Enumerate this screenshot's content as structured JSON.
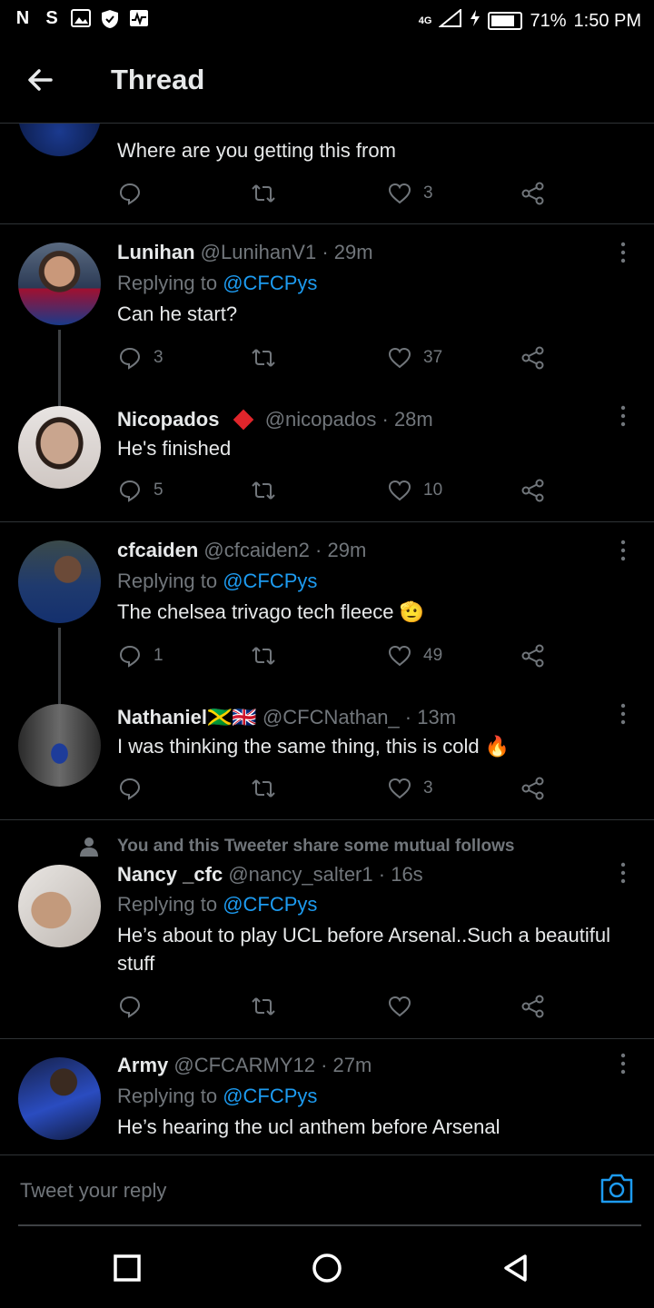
{
  "status_bar": {
    "left_icons": [
      "N",
      "S",
      "gallery-icon",
      "shield-icon",
      "activity-icon"
    ],
    "network": "4G",
    "battery": "71%",
    "battery_level": 0.71,
    "time": "1:50 PM"
  },
  "header": {
    "title": "Thread",
    "back_icon": "arrow-left-icon"
  },
  "tweets": [
    {
      "body": "Where are you getting this from",
      "replies": "",
      "likes": "3"
    },
    {
      "name": "Lunihan",
      "handle": "@LunihanV1",
      "time": "29m",
      "replying_prefix": "Replying to",
      "replying_to": "@CFCPys",
      "body": "Can he start?",
      "replies": "3",
      "likes": "37"
    },
    {
      "name": "Nicopados",
      "badge": "red-diamond-icon",
      "handle": "@nicopados",
      "time": "28m",
      "body": "He's finished",
      "replies": "5",
      "likes": "10"
    },
    {
      "name": "cfcaiden",
      "handle": "@cfcaiden2",
      "time": "29m",
      "replying_prefix": "Replying to",
      "replying_to": "@CFCPys",
      "body": "The chelsea trivago tech fleece 🫡",
      "replies": "1",
      "likes": "49"
    },
    {
      "name": "Nathaniel🇯🇲🇬🇧",
      "handle": "@CFCNathan_",
      "time": "13m",
      "body": "I was thinking the same thing, this is cold 🔥",
      "replies": "",
      "likes": "3"
    },
    {
      "social_context": "You and this Tweeter share some mutual follows",
      "name": "Nancy _cfc",
      "handle": "@nancy_salter1",
      "time": "16s",
      "replying_prefix": "Replying to",
      "replying_to": "@CFCPys",
      "body": "He’s about to play UCL before Arsenal..Such a beautiful stuff",
      "replies": "",
      "likes": ""
    },
    {
      "name": "Army",
      "handle": "@CFCARMY12",
      "time": "27m",
      "replying_prefix": "Replying to",
      "replying_to": "@CFCPys",
      "body": "He’s hearing the ucl anthem before Arsenal"
    }
  ],
  "reply_bar": {
    "placeholder": "Tweet your reply",
    "camera_icon": "camera-icon"
  },
  "nav_bar": {
    "icons": [
      "square-recents-icon",
      "circle-home-icon",
      "triangle-back-icon"
    ]
  },
  "colors": {
    "background": "#000000",
    "accent": "#1d9bf0",
    "muted": "#71767b",
    "divider": "#2f3336"
  }
}
